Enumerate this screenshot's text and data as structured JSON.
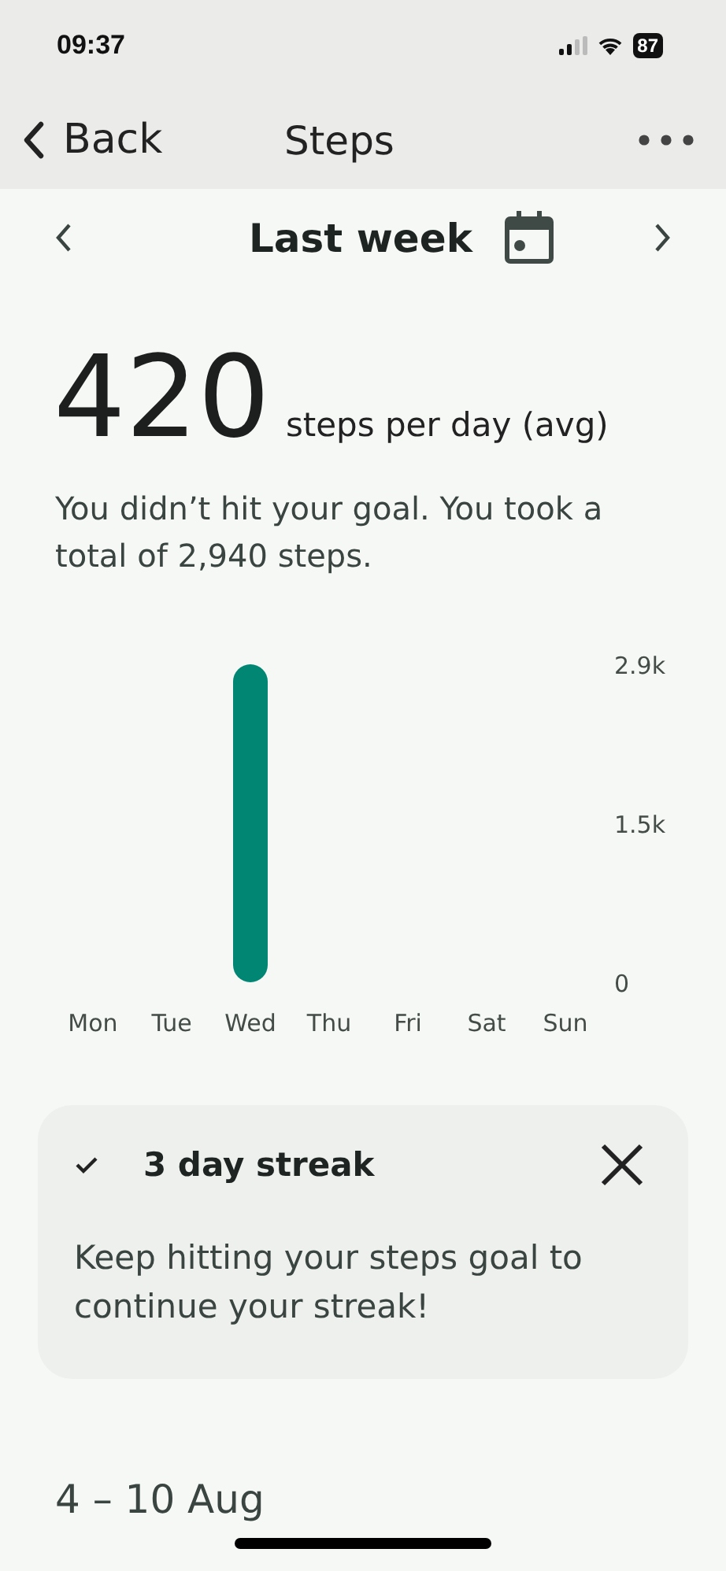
{
  "status_bar": {
    "time": "09:37",
    "battery": "87"
  },
  "nav_bar": {
    "back": "Back",
    "title": "Steps"
  },
  "period": {
    "label": "Last week"
  },
  "summary": {
    "value": "420",
    "unit": "steps per day (avg)",
    "message": "You didn’t hit your goal. You took a total of 2,940 steps."
  },
  "chart_data": {
    "type": "bar",
    "categories": [
      "Mon",
      "Tue",
      "Wed",
      "Thu",
      "Fri",
      "Sat",
      "Sun"
    ],
    "values": [
      0,
      0,
      2940,
      0,
      0,
      0,
      0
    ],
    "ylim": [
      0,
      2940
    ],
    "yticks": [
      {
        "value": 0,
        "label": "0"
      },
      {
        "value": 1470,
        "label": "1.5k"
      },
      {
        "value": 2940,
        "label": "2.9k"
      }
    ],
    "color": "#008672"
  },
  "streak_card": {
    "title": "3 day streak",
    "message": "Keep hitting your steps goal to continue your streak!"
  },
  "next_section": {
    "title": "4 – 10 Aug"
  }
}
